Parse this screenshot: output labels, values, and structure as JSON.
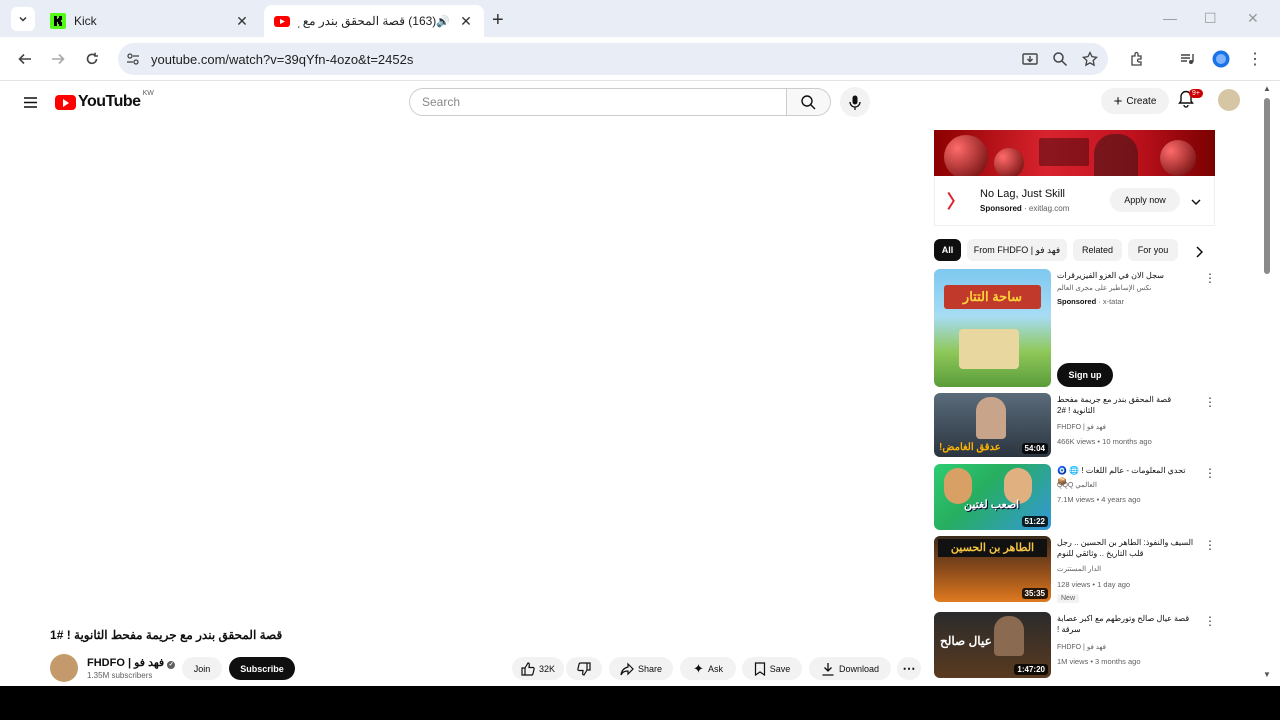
{
  "browser": {
    "tabs": [
      {
        "title": "Kick",
        "favicon": "kick-favicon"
      },
      {
        "title": "(163) قصة المحقق بندر مع ج",
        "favicon": "youtube-favicon"
      }
    ],
    "url": "youtube.com/watch?v=39qYfn-4ozo&t=2452s"
  },
  "yt": {
    "logo": "YouTube",
    "country": "KW",
    "search_placeholder": "Search",
    "create_label": "Create",
    "notif_badge": "9+"
  },
  "video": {
    "title": "قصة المحقق بندر مع جريمة مفحط الثانوية ! #1",
    "channel": "FHDFO | فهد فو",
    "subscribers": "1.35M subscribers",
    "join": "Join",
    "subscribe": "Subscribe",
    "likes": "32K",
    "share": "Share",
    "ask": "Ask",
    "save": "Save",
    "download": "Download"
  },
  "ad": {
    "title": "No Lag, Just Skill",
    "sponsored": "Sponsored",
    "domain": "exitlag.com",
    "apply": "Apply now"
  },
  "chips": [
    "All",
    "From FHDFO | فهد فو",
    "Related",
    "For you"
  ],
  "recs": [
    {
      "title": "سجل الان في الغزو الفيزيرقرات",
      "channel": "نكس الإساطير على مجرى العالم",
      "meta1": "Sponsored",
      "meta2": "x-tatar",
      "action": "Sign up",
      "thumb_text": "ساحة التتار"
    },
    {
      "title": "قصة المحقق بندر مع جريمة مفحط الثانوية ! #2",
      "channel": "FHDFO | فهد فو",
      "meta": "466K views • 10 months ago",
      "duration": "54:04",
      "thumb_text": "عدقق الغامض!"
    },
    {
      "title": "تحدي المعلومات - عالم اللغات ! 🌐 🧿 📦",
      "channel": "QQQ العالمي",
      "meta": "7.1M views • 4 years ago",
      "duration": "51:22",
      "thumb_text": "اصعب لغتين"
    },
    {
      "title": "السيف والنفوذ: الطاهر بن الحسين .. رجل قلب التاريخ .. وثائقي للنوم",
      "channel": "الدار المستترت",
      "meta": "128 views • 1 day ago",
      "badge": "New",
      "duration": "35:35",
      "thumb_text": "الطاهر بن الحسين"
    },
    {
      "title": "قصة عيال صالح وتورطهم مع اكبر عصابة سرقة !",
      "channel": "FHDFO | فهد فو",
      "meta": "1M views • 3 months ago",
      "duration": "1:47:20",
      "thumb_text": "عيال صالح"
    }
  ]
}
